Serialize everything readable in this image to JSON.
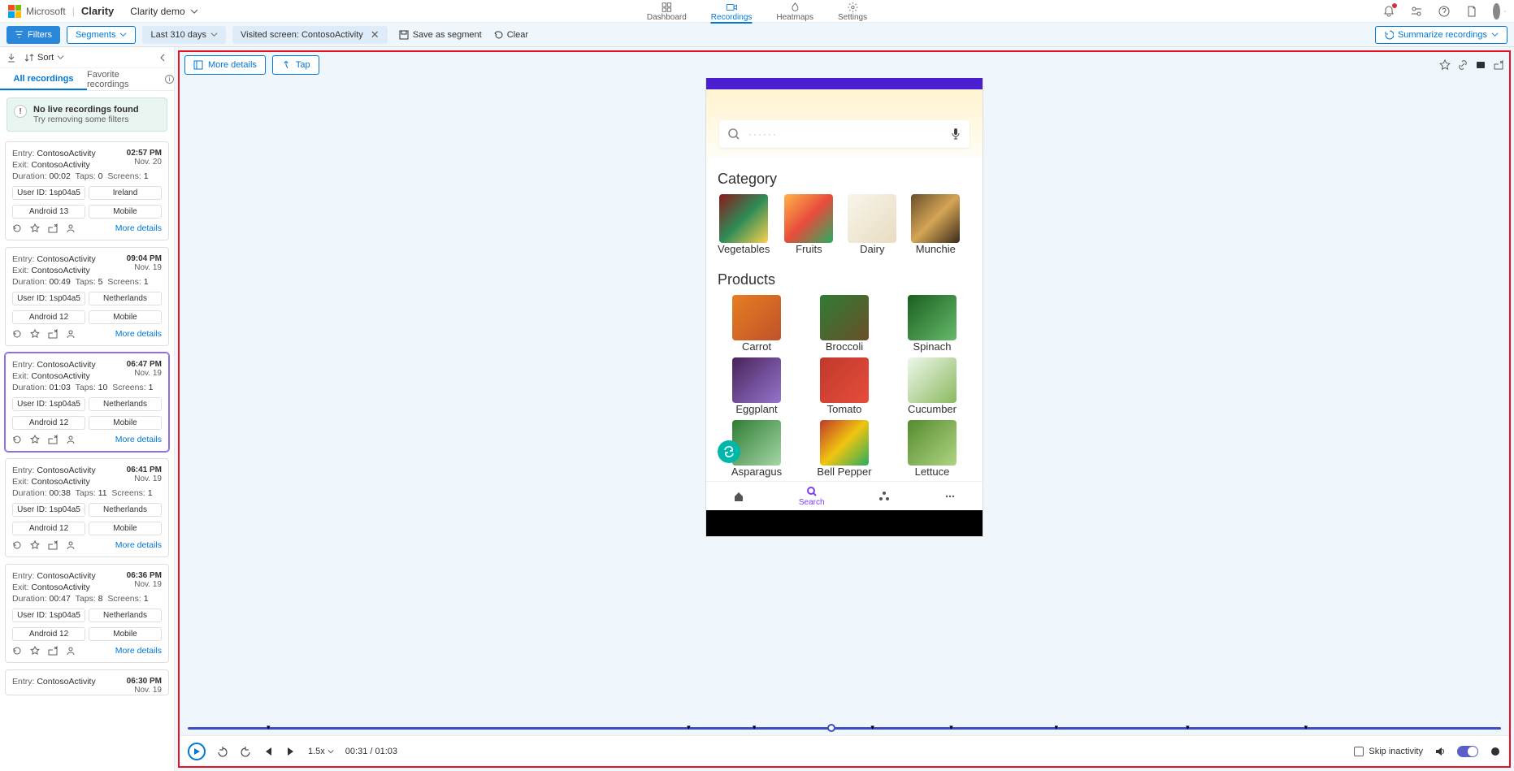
{
  "header": {
    "microsoft": "Microsoft",
    "clarity": "Clarity",
    "project": "Clarity demo",
    "nav": {
      "dashboard": "Dashboard",
      "recordings": "Recordings",
      "heatmaps": "Heatmaps",
      "settings": "Settings"
    }
  },
  "filters": {
    "filters_label": "Filters",
    "segments_label": "Segments",
    "date_label": "Last 310 days",
    "screen_chip": "Visited screen: ContosoActivity",
    "save_segment": "Save as segment",
    "clear": "Clear",
    "summarize": "Summarize recordings"
  },
  "sidebar": {
    "sort": "Sort",
    "tabs": {
      "all": "All recordings",
      "fav": "Favorite recordings"
    },
    "no_live": {
      "title": "No live recordings found",
      "sub": "Try removing some filters"
    },
    "more_details": "More details"
  },
  "recordings": [
    {
      "entry": "ContosoActivity",
      "exit": "ContosoActivity",
      "duration": "00:02",
      "taps": "0",
      "screens": "1",
      "time": "02:57 PM",
      "date": "Nov. 20",
      "user": "1sp04a5",
      "country": "Ireland",
      "os": "Android 13",
      "device": "Mobile",
      "selected": false
    },
    {
      "entry": "ContosoActivity",
      "exit": "ContosoActivity",
      "duration": "00:49",
      "taps": "5",
      "screens": "1",
      "time": "09:04 PM",
      "date": "Nov. 19",
      "user": "1sp04a5",
      "country": "Netherlands",
      "os": "Android 12",
      "device": "Mobile",
      "selected": false
    },
    {
      "entry": "ContosoActivity",
      "exit": "ContosoActivity",
      "duration": "01:03",
      "taps": "10",
      "screens": "1",
      "time": "06:47 PM",
      "date": "Nov. 19",
      "user": "1sp04a5",
      "country": "Netherlands",
      "os": "Android 12",
      "device": "Mobile",
      "selected": true
    },
    {
      "entry": "ContosoActivity",
      "exit": "ContosoActivity",
      "duration": "00:38",
      "taps": "11",
      "screens": "1",
      "time": "06:41 PM",
      "date": "Nov. 19",
      "user": "1sp04a5",
      "country": "Netherlands",
      "os": "Android 12",
      "device": "Mobile",
      "selected": false
    },
    {
      "entry": "ContosoActivity",
      "exit": "ContosoActivity",
      "duration": "00:47",
      "taps": "8",
      "screens": "1",
      "time": "06:36 PM",
      "date": "Nov. 19",
      "user": "1sp04a5",
      "country": "Netherlands",
      "os": "Android 12",
      "device": "Mobile",
      "selected": false
    },
    {
      "entry": "ContosoActivity",
      "exit": "",
      "duration": "",
      "taps": "",
      "screens": "",
      "time": "06:30 PM",
      "date": "Nov. 19",
      "user": "",
      "country": "",
      "os": "",
      "device": "",
      "selected": false
    }
  ],
  "labels": {
    "entry": "Entry:",
    "exit": "Exit:",
    "duration": "Duration:",
    "taps": "Taps:",
    "screens": "Screens:",
    "user": "User ID:"
  },
  "player": {
    "more_details": "More details",
    "tap": "Tap",
    "speed": "1.5x",
    "time": "00:31 / 01:03",
    "skip": "Skip inactivity"
  },
  "app": {
    "search_placeholder": "······",
    "category_title": "Category",
    "categories": [
      "Vegetables",
      "Fruits",
      "Dairy",
      "Munchie"
    ],
    "products_title": "Products",
    "products": [
      "Carrot",
      "Broccoli",
      "Spinach",
      "Eggplant",
      "Tomato",
      "Cucumber",
      "Asparagus",
      "Bell Pepper",
      "Lettuce"
    ],
    "bottom_search": "Search"
  },
  "timeline": {
    "knob_pct": 49,
    "marks_pct": [
      6,
      38,
      43,
      52,
      58,
      66,
      76,
      85
    ]
  }
}
